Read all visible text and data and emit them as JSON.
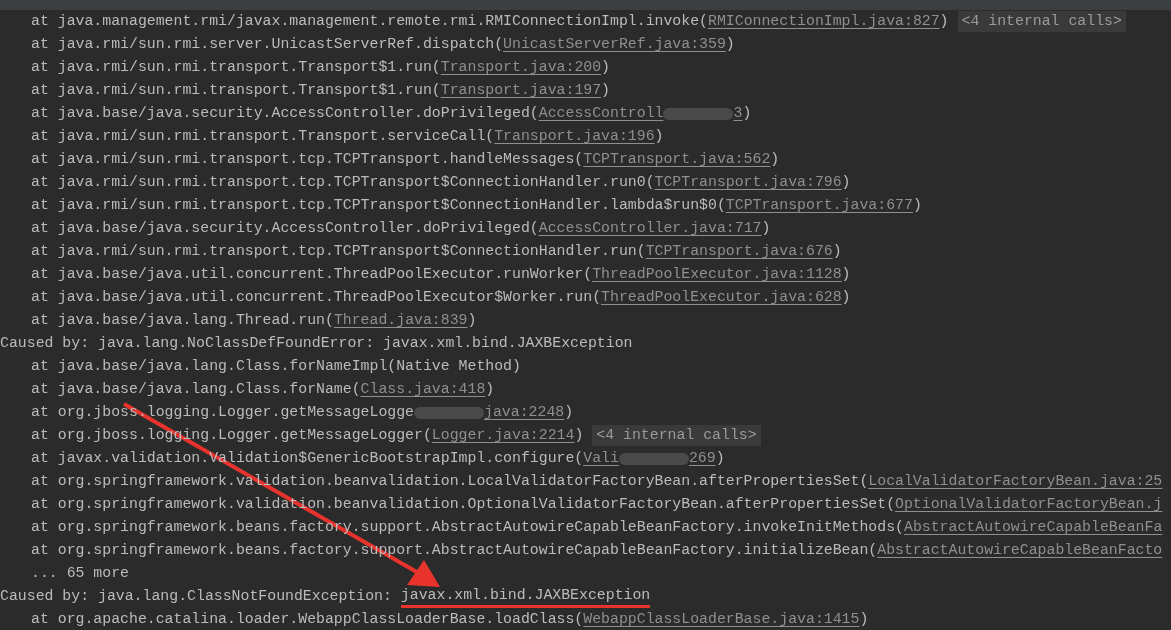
{
  "console": {
    "lines": [
      {
        "kind": "frame",
        "parts": [
          {
            "kind": "text",
            "text": "at java.management.rmi/javax.management.remote.rmi.RMIConnectionImpl.invoke("
          },
          {
            "kind": "link",
            "text": "RMIConnectionImpl.java:827"
          },
          {
            "kind": "text",
            "text": ")"
          },
          {
            "kind": "badge",
            "text": "<4 internal calls>"
          }
        ]
      },
      {
        "kind": "frame",
        "parts": [
          {
            "kind": "text",
            "text": "at java.rmi/sun.rmi.server.UnicastServerRef.dispatch("
          },
          {
            "kind": "link",
            "text": "UnicastServerRef.java:359"
          },
          {
            "kind": "text",
            "text": ")"
          }
        ]
      },
      {
        "kind": "frame",
        "parts": [
          {
            "kind": "text",
            "text": "at java.rmi/sun.rmi.transport.Transport$1.run("
          },
          {
            "kind": "link",
            "text": "Transport.java:200"
          },
          {
            "kind": "text",
            "text": ")"
          }
        ]
      },
      {
        "kind": "frame",
        "parts": [
          {
            "kind": "text",
            "text": "at java.rmi/sun.rmi.transport.Transport$1.run("
          },
          {
            "kind": "link",
            "text": "Transport.java:197"
          },
          {
            "kind": "text",
            "text": ")"
          }
        ]
      },
      {
        "kind": "frame",
        "parts": [
          {
            "kind": "text",
            "text": "at java.base/java.security.AccessController.doPrivileged("
          },
          {
            "kind": "link",
            "text": "AccessControll"
          },
          {
            "kind": "blur"
          },
          {
            "kind": "link",
            "text": "3"
          },
          {
            "kind": "text",
            "text": ")"
          }
        ]
      },
      {
        "kind": "frame",
        "parts": [
          {
            "kind": "text",
            "text": "at java.rmi/sun.rmi.transport.Transport.serviceCall("
          },
          {
            "kind": "link",
            "text": "Transport.java:196"
          },
          {
            "kind": "text",
            "text": ")"
          }
        ]
      },
      {
        "kind": "frame",
        "parts": [
          {
            "kind": "text",
            "text": "at java.rmi/sun.rmi.transport.tcp.TCPTransport.handleMessages("
          },
          {
            "kind": "link",
            "text": "TCPTransport.java:562"
          },
          {
            "kind": "text",
            "text": ")"
          }
        ]
      },
      {
        "kind": "frame",
        "parts": [
          {
            "kind": "text",
            "text": "at java.rmi/sun.rmi.transport.tcp.TCPTransport$ConnectionHandler.run0("
          },
          {
            "kind": "link",
            "text": "TCPTransport.java:796"
          },
          {
            "kind": "text",
            "text": ")"
          }
        ]
      },
      {
        "kind": "frame",
        "parts": [
          {
            "kind": "text",
            "text": "at java.rmi/sun.rmi.transport.tcp.TCPTransport$ConnectionHandler.lambda$run$0("
          },
          {
            "kind": "link",
            "text": "TCPTransport.java:677"
          },
          {
            "kind": "text",
            "text": ")"
          }
        ]
      },
      {
        "kind": "frame",
        "parts": [
          {
            "kind": "text",
            "text": "at java.base/java.security.AccessController.doPrivileged("
          },
          {
            "kind": "link",
            "text": "AccessController.java:717"
          },
          {
            "kind": "text",
            "text": ")"
          }
        ]
      },
      {
        "kind": "frame",
        "parts": [
          {
            "kind": "text",
            "text": "at java.rmi/sun.rmi.transport.tcp.TCPTransport$ConnectionHandler.run("
          },
          {
            "kind": "link",
            "text": "TCPTransport.java:676"
          },
          {
            "kind": "text",
            "text": ")"
          }
        ]
      },
      {
        "kind": "frame",
        "parts": [
          {
            "kind": "text",
            "text": "at java.base/java.util.concurrent.ThreadPoolExecutor.runWorker("
          },
          {
            "kind": "link",
            "text": "ThreadPoolExecutor.java:1128"
          },
          {
            "kind": "text",
            "text": ")"
          }
        ]
      },
      {
        "kind": "frame",
        "parts": [
          {
            "kind": "text",
            "text": "at java.base/java.util.concurrent.ThreadPoolExecutor$Worker.run("
          },
          {
            "kind": "link",
            "text": "ThreadPoolExecutor.java:628"
          },
          {
            "kind": "text",
            "text": ")"
          }
        ]
      },
      {
        "kind": "frame",
        "parts": [
          {
            "kind": "text",
            "text": "at java.base/java.lang.Thread.run("
          },
          {
            "kind": "link",
            "text": "Thread.java:839"
          },
          {
            "kind": "text",
            "text": ")"
          }
        ]
      },
      {
        "kind": "caused",
        "parts": [
          {
            "kind": "text",
            "text": "Caused by: java.lang.NoClassDefFoundError: javax.xml.bind.JAXBException"
          }
        ]
      },
      {
        "kind": "frame",
        "parts": [
          {
            "kind": "text",
            "text": "at java.base/java.lang.Class.forNameImpl(Native Method)"
          }
        ]
      },
      {
        "kind": "frame",
        "parts": [
          {
            "kind": "text",
            "text": "at java.base/java.lang.Class.forName("
          },
          {
            "kind": "link",
            "text": "Class.java:418"
          },
          {
            "kind": "text",
            "text": ")"
          }
        ]
      },
      {
        "kind": "frame",
        "parts": [
          {
            "kind": "text",
            "text": "at org.jboss.logging.Logger.getMessageLogge"
          },
          {
            "kind": "blur"
          },
          {
            "kind": "link",
            "text": "java:2248"
          },
          {
            "kind": "text",
            "text": ")"
          }
        ]
      },
      {
        "kind": "frame",
        "parts": [
          {
            "kind": "text",
            "text": "at org.jboss.logging.Logger.getMessageLogger("
          },
          {
            "kind": "link",
            "text": "Logger.java:2214"
          },
          {
            "kind": "text",
            "text": ")"
          },
          {
            "kind": "badge",
            "text": "<4 internal calls>"
          }
        ]
      },
      {
        "kind": "frame",
        "parts": [
          {
            "kind": "text",
            "text": "at javax.validation.Validation$GenericBootstrapImpl.configure("
          },
          {
            "kind": "link",
            "text": "Vali"
          },
          {
            "kind": "blur"
          },
          {
            "kind": "link",
            "text": "269"
          },
          {
            "kind": "text",
            "text": ")"
          }
        ]
      },
      {
        "kind": "frame",
        "parts": [
          {
            "kind": "text",
            "text": "at org.springframework.validation.beanvalidation.LocalValidatorFactoryBean.afterPropertiesSet("
          },
          {
            "kind": "link",
            "text": "LocalValidatorFactoryBean.java:25"
          }
        ]
      },
      {
        "kind": "frame",
        "parts": [
          {
            "kind": "text",
            "text": "at org.springframework.validation.beanvalidation.OptionalValidatorFactoryBean.afterPropertiesSet("
          },
          {
            "kind": "link",
            "text": "OptionalValidatorFactoryBean.j"
          }
        ]
      },
      {
        "kind": "frame",
        "parts": [
          {
            "kind": "text",
            "text": "at org.springframework.beans.factory.support.AbstractAutowireCapableBeanFactory.invokeInitMethods("
          },
          {
            "kind": "link",
            "text": "AbstractAutowireCapableBeanFa"
          }
        ]
      },
      {
        "kind": "frame",
        "parts": [
          {
            "kind": "text",
            "text": "at org.springframework.beans.factory.support.AbstractAutowireCapableBeanFactory.initializeBean("
          },
          {
            "kind": "link",
            "text": "AbstractAutowireCapableBeanFacto"
          }
        ]
      },
      {
        "kind": "frame",
        "parts": [
          {
            "kind": "text",
            "text": "... 65 more"
          }
        ]
      },
      {
        "kind": "caused",
        "parts": [
          {
            "kind": "text",
            "text": "Caused by: java.lang.ClassNotFoundException: "
          },
          {
            "kind": "marked",
            "text": "javax.xml.bind.JAXBException"
          }
        ]
      },
      {
        "kind": "frame",
        "parts": [
          {
            "kind": "text",
            "text": "at org.apache.catalina.loader.WebappClassLoaderBase.loadClass("
          },
          {
            "kind": "link",
            "text": "WebappClassLoaderBase.java:1415"
          },
          {
            "kind": "text",
            "text": ")"
          }
        ]
      }
    ]
  }
}
